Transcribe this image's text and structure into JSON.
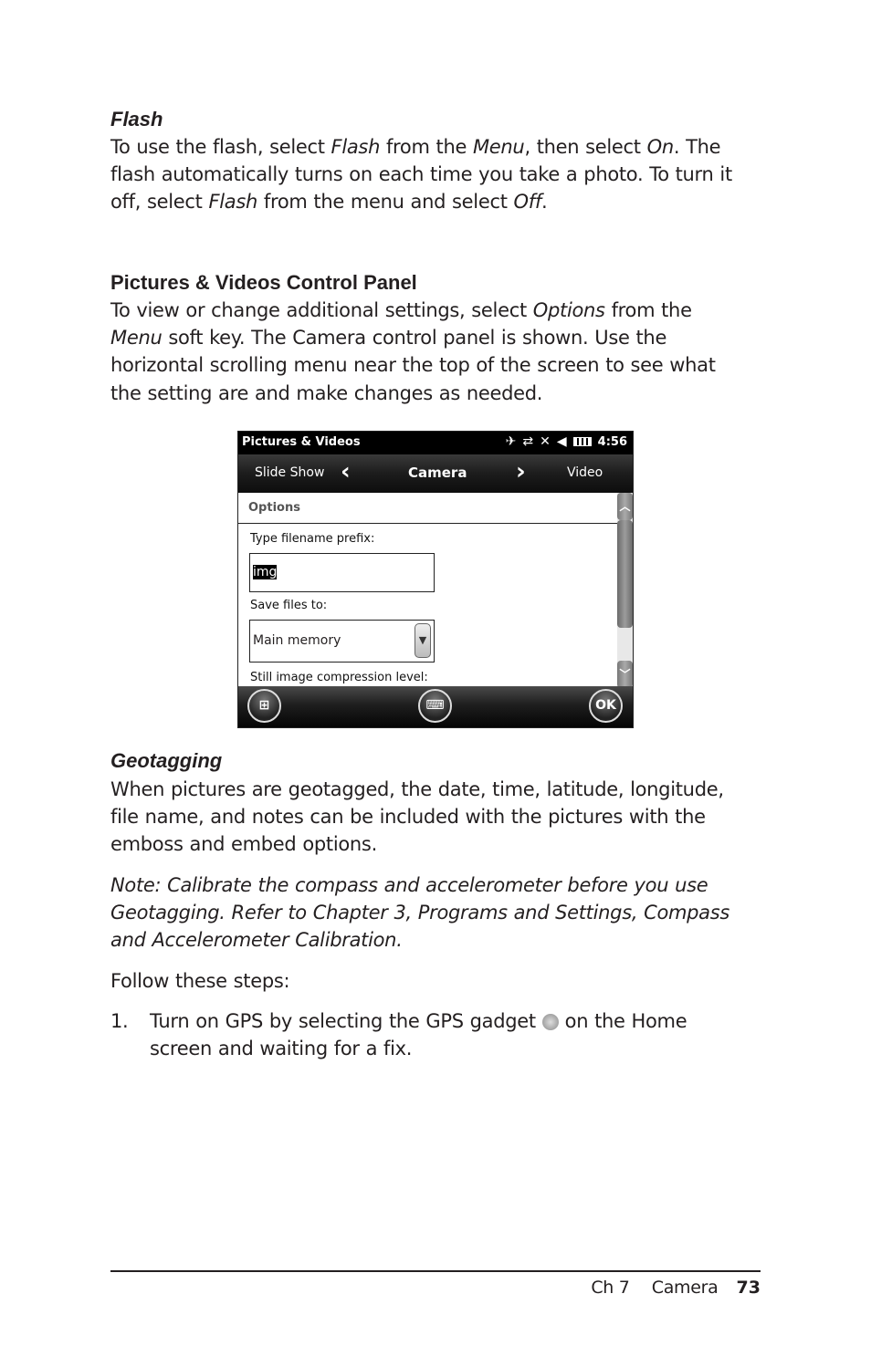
{
  "sections": {
    "flash": {
      "heading": "Flash",
      "body": [
        {
          "t": "To use the flash, select "
        },
        {
          "t": "Flash",
          "i": true
        },
        {
          "t": " from the "
        },
        {
          "t": "Menu",
          "i": true
        },
        {
          "t": ", then select "
        },
        {
          "t": "On",
          "i": true
        },
        {
          "t": ". The flash automatically turns on each time you take a photo. To turn it off, select "
        },
        {
          "t": "Flash",
          "i": true
        },
        {
          "t": " from the menu and select "
        },
        {
          "t": "Off",
          "i": true
        },
        {
          "t": "."
        }
      ]
    },
    "control_panel": {
      "heading": "Pictures & Videos Control Panel",
      "body": [
        {
          "t": "To view or change additional settings, select "
        },
        {
          "t": "Options",
          "i": true
        },
        {
          "t": " from the "
        },
        {
          "t": "Menu",
          "i": true
        },
        {
          "t": " soft key. The Camera control panel is shown. Use the horizontal scrolling menu near the top of the screen to see what the setting are and make changes as needed."
        }
      ]
    },
    "geotagging": {
      "heading": "Geotagging",
      "body": "When pictures are geotagged, the date, time, latitude, longitude, file name, and notes can be included with the pictures with the emboss and embed options.",
      "note": "Note: Calibrate the compass and accelerometer before you use Geotagging. Refer to Chapter 3, Programs and Settings, Compass and Accelerometer Calibration.",
      "steps_intro": "Follow these steps:",
      "steps": [
        {
          "num": "1.",
          "before": "Turn on GPS by selecting the GPS gadget",
          "icon": "gps-gadget-icon",
          "after": "on the Home screen and waiting for a fix."
        }
      ]
    }
  },
  "screenshot": {
    "app_title": "Pictures & Videos",
    "time": "4:56",
    "status_icons": [
      "gps-satellite-icon",
      "data-sync-icon",
      "no-signal-icon",
      "volume-icon",
      "battery-icon"
    ],
    "nav": {
      "left": "Slide Show",
      "center": "Camera",
      "right": "Video"
    },
    "options_header": "Options",
    "filename_label": "Type filename prefix:",
    "filename_value": "img",
    "save_label": "Save files to:",
    "save_value": "Main memory",
    "compression_label": "Still image compression level:",
    "softkeys": {
      "start": "start-icon",
      "keyboard": "keyboard-icon",
      "ok": "OK"
    }
  },
  "footer": {
    "chapter": "Ch 7",
    "section": "Camera",
    "page": "73"
  }
}
